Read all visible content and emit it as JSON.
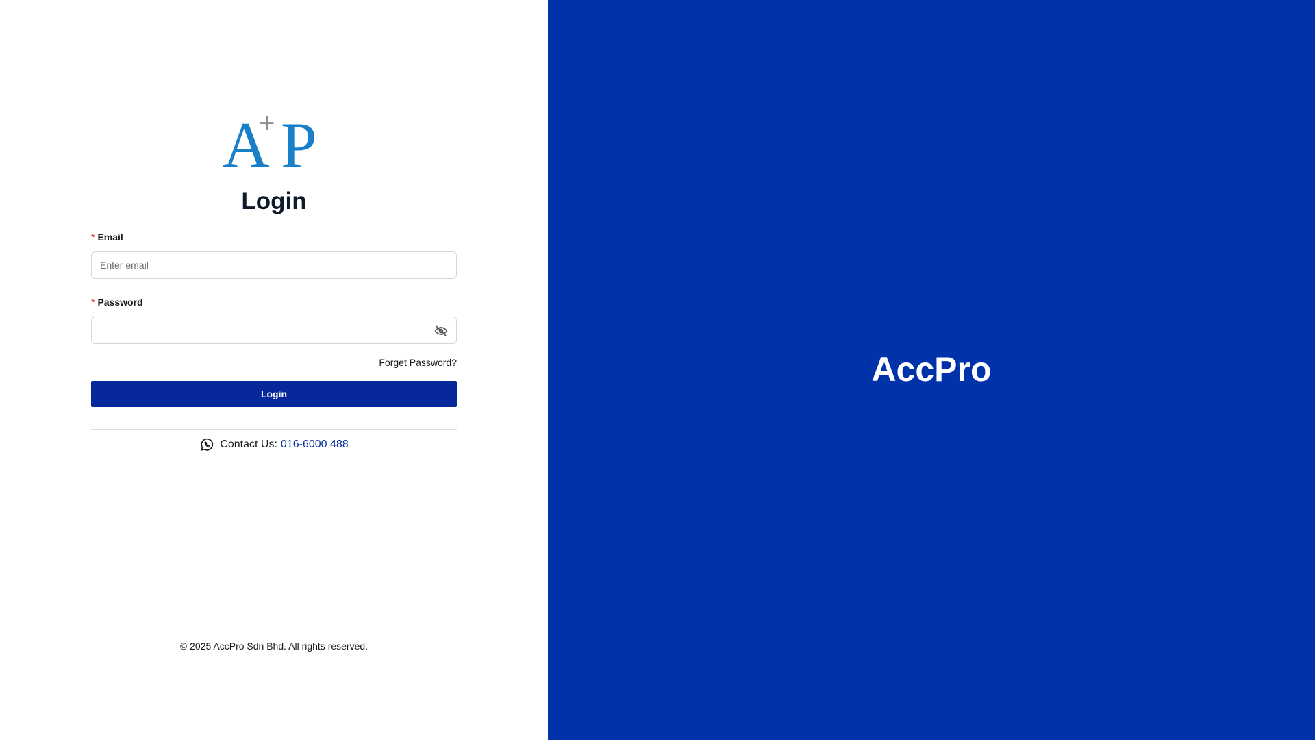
{
  "logo": {
    "letter_a": "A",
    "plus": "+",
    "letter_p": "P"
  },
  "login": {
    "title": "Login",
    "email_required_marker": "*",
    "email_label": "Email",
    "email_placeholder": "Enter email",
    "email_value": "",
    "password_required_marker": "*",
    "password_label": "Password",
    "password_value": "",
    "password_visibility_icon": "eye-slash-icon",
    "forgot_password": "Forget Password?",
    "submit_label": "Login"
  },
  "contact": {
    "icon": "whatsapp-icon",
    "label": "Contact Us:",
    "phone": "016-6000 488"
  },
  "footer": {
    "copyright": "© 2025 AccPro Sdn Bhd. All rights reserved."
  },
  "brand_panel": {
    "title": "AccPro"
  },
  "colors": {
    "brand_blue": "#0032aa",
    "button_blue": "#07289a",
    "logo_blue": "#1a7fc9",
    "logo_plus_gray": "#8e8e8e",
    "required_red": "#e0272b",
    "link_blue": "#0a2fa0"
  }
}
